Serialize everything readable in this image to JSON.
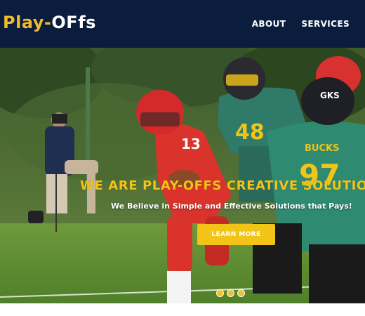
{
  "brand": {
    "part1": "Play",
    "dash": "-",
    "part2": "OFfs"
  },
  "nav": {
    "items": [
      {
        "label": "ABOUT"
      },
      {
        "label": "SERVICES"
      }
    ]
  },
  "hero": {
    "headline": "WE ARE PLAY-OFFS CREATIVE SOLUTIO",
    "subline": "We Believe in Simple and Effective Solutions that Pays!",
    "cta_label": "LEARN MORE",
    "jersey_numbers": {
      "red": "13",
      "green_left": "48",
      "green_right": "97"
    },
    "jersey_text": "BUCKS",
    "helmet_text": "GKS",
    "slides": 3,
    "active_slide": 1
  },
  "colors": {
    "header_bg": "#0b1d3d",
    "accent": "#f2c418",
    "brand_yellow": "#f2b92a"
  }
}
